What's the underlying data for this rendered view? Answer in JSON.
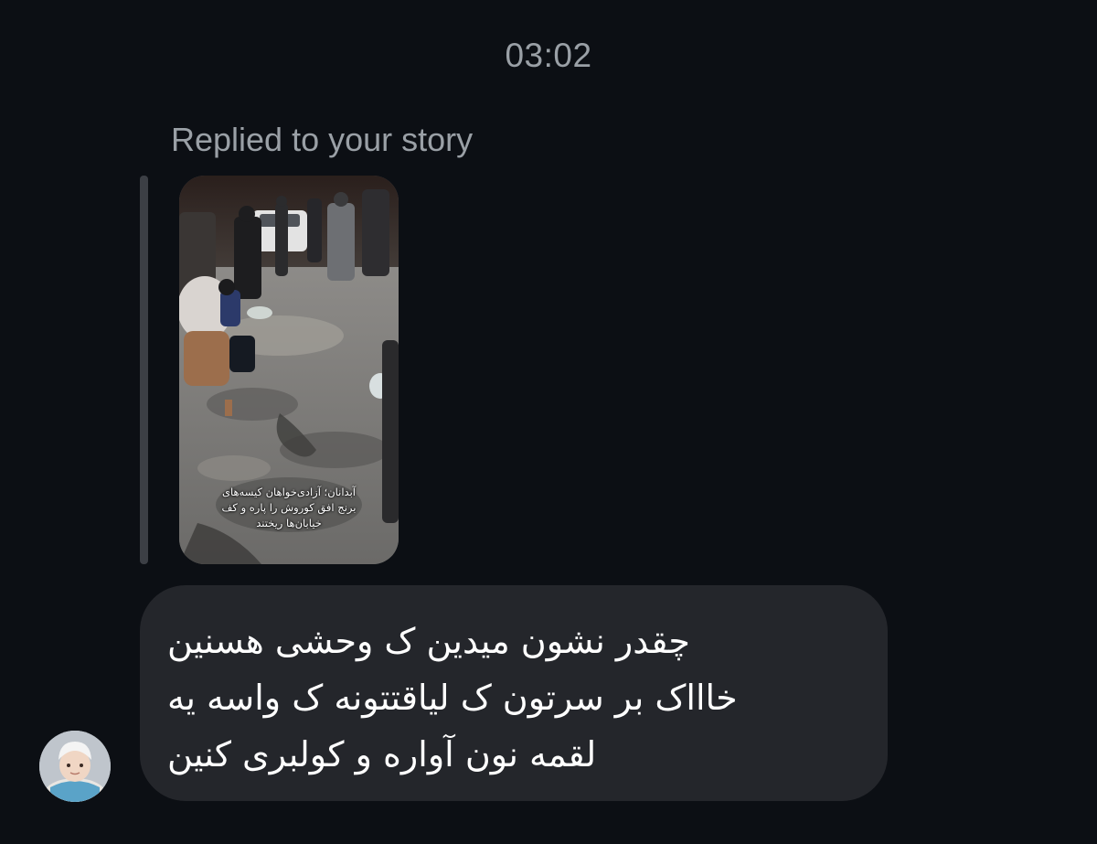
{
  "thread": {
    "timestamp": "03:02",
    "reply_label": "Replied to your story"
  },
  "story": {
    "caption_lines": [
      "آبدانان؛ آزادی‌خواهان کیسه‌های",
      "برنج افق کوروش را پاره و کف",
      "خیابان‌ها ریختند"
    ]
  },
  "message": {
    "lines": [
      "چقدر نشون میدین ک وحشی هسنین",
      "خاااک بر سرتون ک لیاقتتونه ک واسه یه",
      "لقمه نون آواره و کولبری کنین"
    ]
  },
  "sender": {
    "avatar_icon": "baby-avatar-icon"
  },
  "colors": {
    "background": "#0c0f14",
    "bubble": "#24262b",
    "muted_text": "#9aa0a6",
    "reply_bar": "#3c3f45"
  }
}
